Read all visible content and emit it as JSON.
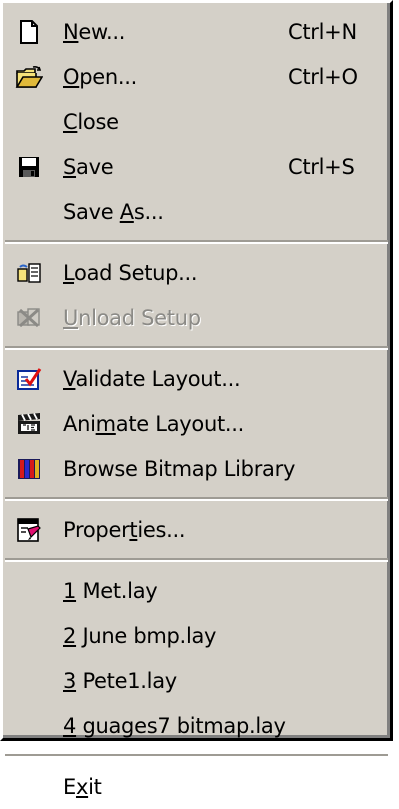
{
  "menu": {
    "group1": [
      {
        "id": "new",
        "pre": "",
        "acc": "N",
        "post": "ew...",
        "shortcut": "Ctrl+N",
        "icon": "new-document-icon"
      },
      {
        "id": "open",
        "pre": "",
        "acc": "O",
        "post": "pen...",
        "shortcut": "Ctrl+O",
        "icon": "open-folder-icon"
      },
      {
        "id": "close",
        "pre": "",
        "acc": "C",
        "post": "lose",
        "shortcut": "",
        "icon": ""
      },
      {
        "id": "save",
        "pre": "",
        "acc": "S",
        "post": "ave",
        "shortcut": "Ctrl+S",
        "icon": "floppy-disk-icon"
      },
      {
        "id": "save-as",
        "pre": "Save ",
        "acc": "A",
        "post": "s...",
        "shortcut": "",
        "icon": ""
      }
    ],
    "group2": [
      {
        "id": "load-setup",
        "pre": "",
        "acc": "L",
        "post": "oad Setup...",
        "shortcut": "",
        "icon": "load-setup-icon",
        "disabled": false
      },
      {
        "id": "unload-setup",
        "pre": "",
        "acc": "U",
        "post": "nload Setup",
        "shortcut": "",
        "icon": "unload-setup-icon",
        "disabled": true
      }
    ],
    "group3": [
      {
        "id": "validate-layout",
        "pre": "",
        "acc": "V",
        "post": "alidate Layout...",
        "icon": "checklist-icon"
      },
      {
        "id": "animate-layout",
        "pre": "Ani",
        "acc": "m",
        "post": "ate Layout...",
        "icon": "clapperboard-icon"
      },
      {
        "id": "browse-bitmap-library",
        "pre": "Browse Bitmap Library",
        "acc": "",
        "post": "",
        "icon": "books-icon"
      }
    ],
    "group4": [
      {
        "id": "properties",
        "pre": "Proper",
        "acc": "t",
        "post": "ies...",
        "icon": "properties-icon"
      }
    ],
    "recent": [
      {
        "id": "recent-1",
        "acc": "1",
        "post": " Met.lay"
      },
      {
        "id": "recent-2",
        "acc": "2",
        "post": " June bmp.lay"
      },
      {
        "id": "recent-3",
        "acc": "3",
        "post": " Pete1.lay"
      },
      {
        "id": "recent-4",
        "acc": "4",
        "post": " guages7 bitmap.lay"
      }
    ],
    "exit": {
      "pre": "E",
      "acc": "x",
      "post": "it"
    }
  }
}
